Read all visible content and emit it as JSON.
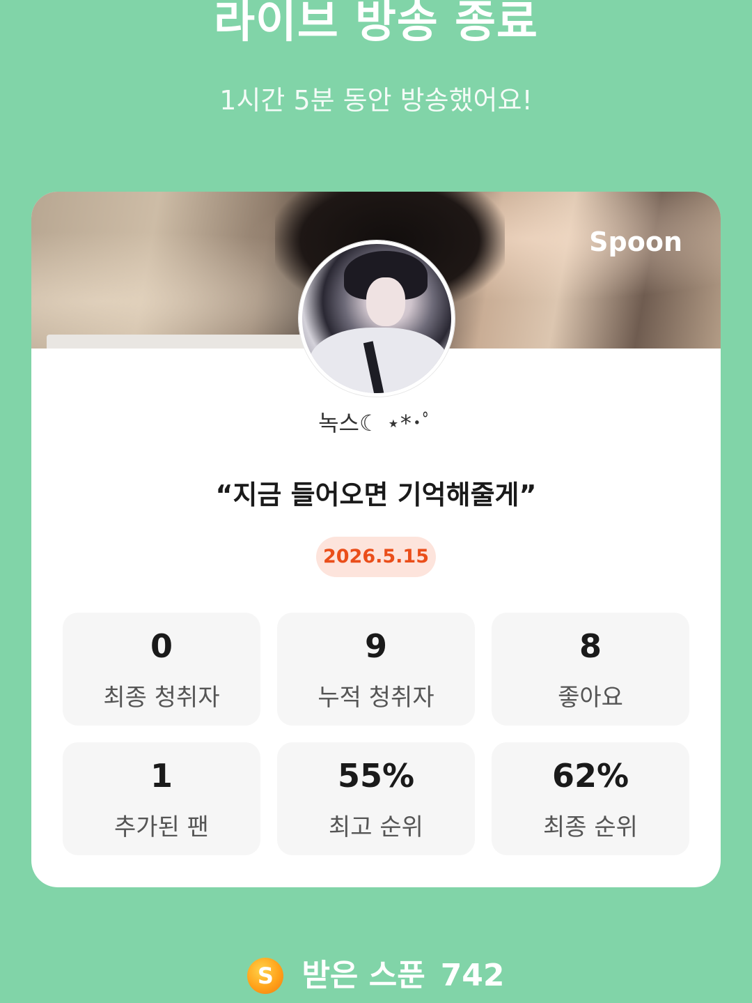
{
  "header": {
    "title": "라이브 방송 종료",
    "subtitle": "1시간 5분 동안 방송했어요!"
  },
  "card": {
    "brand": "Spoon",
    "nickname": "녹스☾ ⋆*･ﾟ",
    "broadcast_title": "“지금 들어오면 기억해줄게”",
    "date": "2026.5.15",
    "stats": [
      {
        "value": "0",
        "label": "최종 청취자"
      },
      {
        "value": "9",
        "label": "누적 청취자"
      },
      {
        "value": "8",
        "label": "좋아요"
      },
      {
        "value": "1",
        "label": "추가된 팬"
      },
      {
        "value": "55%",
        "label": "최고 순위"
      },
      {
        "value": "62%",
        "label": "최종 순위"
      }
    ]
  },
  "footer": {
    "coin_symbol": "S",
    "label": "받은 스푼",
    "count": "742"
  },
  "colors": {
    "background": "#81d4a8",
    "date_badge_bg": "#fde4dc",
    "date_text": "#ea4e1a",
    "coin": "#ffa21a"
  },
  "icons": [
    "spoon-coin-icon"
  ]
}
